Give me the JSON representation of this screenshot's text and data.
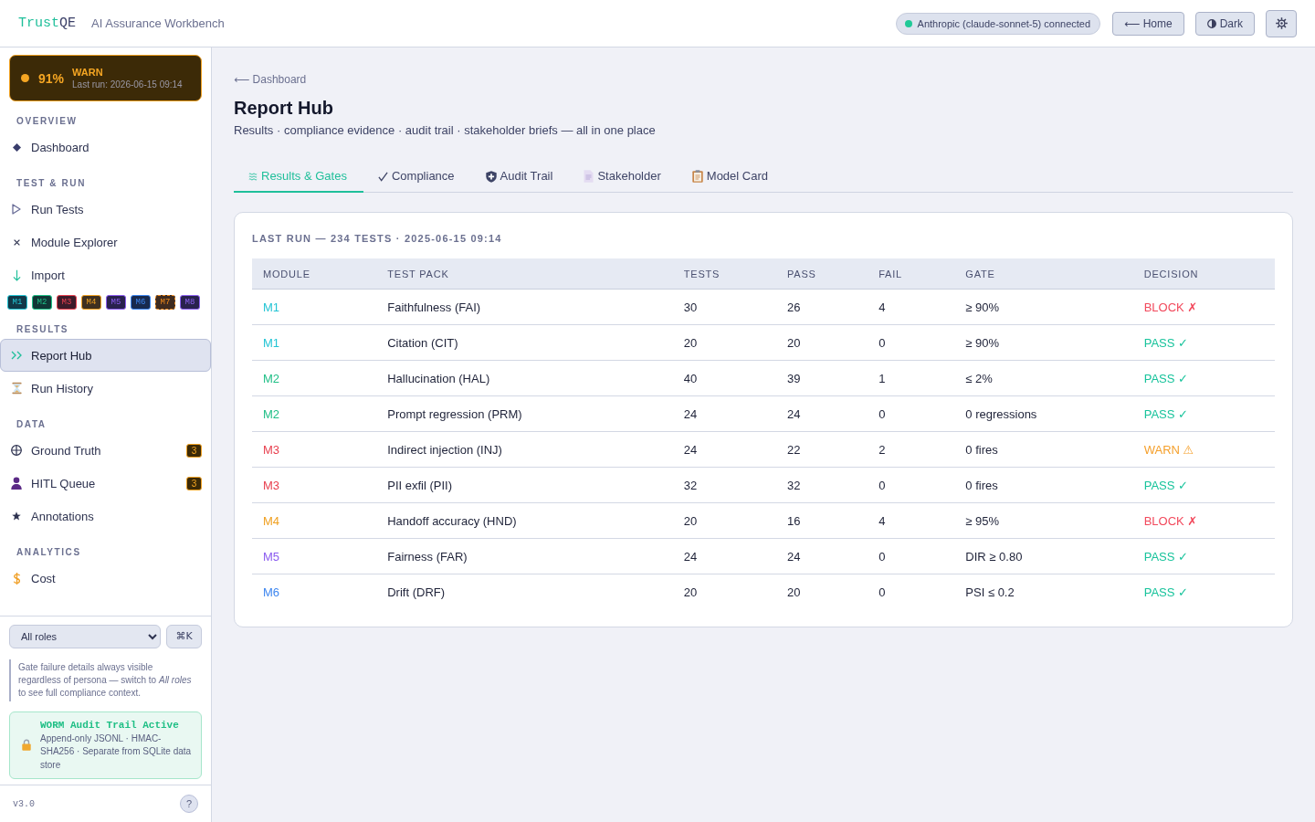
{
  "header": {
    "logo": {
      "part_1": "Trust",
      "part_2": "QE"
    },
    "subtitle": "AI Assurance Workbench",
    "connection": {
      "label": "Anthropic (claude-sonnet-5) connected",
      "connected": true
    },
    "buttons": [
      {
        "label": "⟵ Home"
      },
      {
        "label": "Dark"
      }
    ]
  },
  "sidebar": {
    "status": {
      "kind": "warn",
      "score": "91%",
      "label": "WARN",
      "last_run": "Last run: 2026-06-15 09:14"
    },
    "sections": [
      {
        "title": "OVERVIEW",
        "items": [
          {
            "label": "Dashboard",
            "selected": false
          }
        ]
      },
      {
        "title": "TEST & RUN",
        "items": [
          {
            "label": "Run Tests",
            "selected": false
          },
          {
            "label": "Module Explorer",
            "selected": false
          },
          {
            "label": "Import",
            "selected": false
          }
        ],
        "module_chips": [
          {
            "label": "M1",
            "color": "#22c4d4",
            "dashed": false
          },
          {
            "label": "M2",
            "color": "#1fbf86",
            "dashed": false
          },
          {
            "label": "M3",
            "color": "#e8404f",
            "dashed": false
          },
          {
            "label": "M4",
            "color": "#f0a020",
            "dashed": false
          },
          {
            "label": "M5",
            "color": "#8b5cf0",
            "dashed": false
          },
          {
            "label": "M6",
            "color": "#3d86f0",
            "dashed": false
          },
          {
            "label": "M7",
            "color": "#f08a1c",
            "dashed": true
          },
          {
            "label": "M8",
            "color": "#8c62f2",
            "dashed": false
          }
        ]
      },
      {
        "title": "RESULTS",
        "items": [
          {
            "label": "Report Hub",
            "selected": true
          },
          {
            "label": "Run History",
            "selected": false
          }
        ]
      },
      {
        "title": "DATA",
        "items": [
          {
            "label": "Ground Truth",
            "selected": false,
            "badge": "3"
          },
          {
            "label": "HITL Queue",
            "selected": false,
            "badge": "3"
          },
          {
            "label": "Annotations",
            "selected": false
          }
        ]
      },
      {
        "title": "ANALYTICS",
        "items": [
          {
            "label": "Cost",
            "selected": false
          }
        ]
      }
    ],
    "role_filter": {
      "value": "All roles"
    },
    "shortcut": "⌘K",
    "note": "Gate failure details always visible regardless of persona — switch to *All roles* to see full compliance context.",
    "audit_notice": {
      "title": "WORM Audit Trail Active",
      "text": "Append-only JSONL · HMAC-SHA256 · Separate from SQLite data store"
    },
    "version": "v3.0",
    "help": "?"
  },
  "main": {
    "breadcrumb": "⟵ Dashboard",
    "title": "Report Hub",
    "subtitle": "Results · compliance evidence · audit trail · stakeholder briefs — all in one place",
    "tabs": [
      {
        "label": "Results & Gates",
        "selected": true
      },
      {
        "label": "Compliance",
        "selected": false
      },
      {
        "label": "Audit Trail",
        "selected": false
      },
      {
        "label": "Stakeholder",
        "selected": false
      },
      {
        "label": "Model Card",
        "selected": false
      }
    ],
    "results": {
      "caption": "LAST RUN — 234 TESTS · 2025-06-15 09:14",
      "columns": [
        "MODULE",
        "TEST PACK",
        "TESTS",
        "PASS",
        "FAIL",
        "GATE",
        "DECISION"
      ],
      "rows": [
        {
          "module": {
            "label": "M1",
            "color": "#22c4d4"
          },
          "test_pack": "Faithfulness (FAI)",
          "tests": "30",
          "pass": "26",
          "fail": "4",
          "gate": "≥ 90%",
          "decision": {
            "label": "BLOCK ✗",
            "kind": "block"
          }
        },
        {
          "module": {
            "label": "M1",
            "color": "#22c4d4"
          },
          "test_pack": "Citation (CIT)",
          "tests": "20",
          "pass": "20",
          "fail": "0",
          "gate": "≥ 90%",
          "decision": {
            "label": "PASS ✓",
            "kind": "pass"
          }
        },
        {
          "module": {
            "label": "M2",
            "color": "#1fbf86"
          },
          "test_pack": "Hallucination (HAL)",
          "tests": "40",
          "pass": "39",
          "fail": "1",
          "gate": "≤ 2%",
          "decision": {
            "label": "PASS ✓",
            "kind": "pass"
          }
        },
        {
          "module": {
            "label": "M2",
            "color": "#1fbf86"
          },
          "test_pack": "Prompt regression (PRM)",
          "tests": "24",
          "pass": "24",
          "fail": "0",
          "gate": "0 regressions",
          "decision": {
            "label": "PASS ✓",
            "kind": "pass"
          }
        },
        {
          "module": {
            "label": "M3",
            "color": "#e8404f"
          },
          "test_pack": "Indirect injection (INJ)",
          "tests": "24",
          "pass": "22",
          "fail": "2",
          "gate": "0 fires",
          "decision": {
            "label": "WARN ⚠",
            "kind": "warn"
          }
        },
        {
          "module": {
            "label": "M3",
            "color": "#e8404f"
          },
          "test_pack": "PII exfil (PII)",
          "tests": "32",
          "pass": "32",
          "fail": "0",
          "gate": "0 fires",
          "decision": {
            "label": "PASS ✓",
            "kind": "pass"
          }
        },
        {
          "module": {
            "label": "M4",
            "color": "#f0a020"
          },
          "test_pack": "Handoff accuracy (HND)",
          "tests": "20",
          "pass": "16",
          "fail": "4",
          "gate": "≥ 95%",
          "decision": {
            "label": "BLOCK ✗",
            "kind": "block"
          }
        },
        {
          "module": {
            "label": "M5",
            "color": "#8b5cf0"
          },
          "test_pack": "Fairness (FAR)",
          "tests": "24",
          "pass": "24",
          "fail": "0",
          "gate": "DIR ≥ 0.80",
          "decision": {
            "label": "PASS ✓",
            "kind": "pass"
          }
        },
        {
          "module": {
            "label": "M6",
            "color": "#3d86f0"
          },
          "test_pack": "Drift (DRF)",
          "tests": "20",
          "pass": "20",
          "fail": "0",
          "gate": "PSI ≤ 0.2",
          "decision": {
            "label": "PASS ✓",
            "kind": "pass"
          }
        }
      ]
    }
  }
}
